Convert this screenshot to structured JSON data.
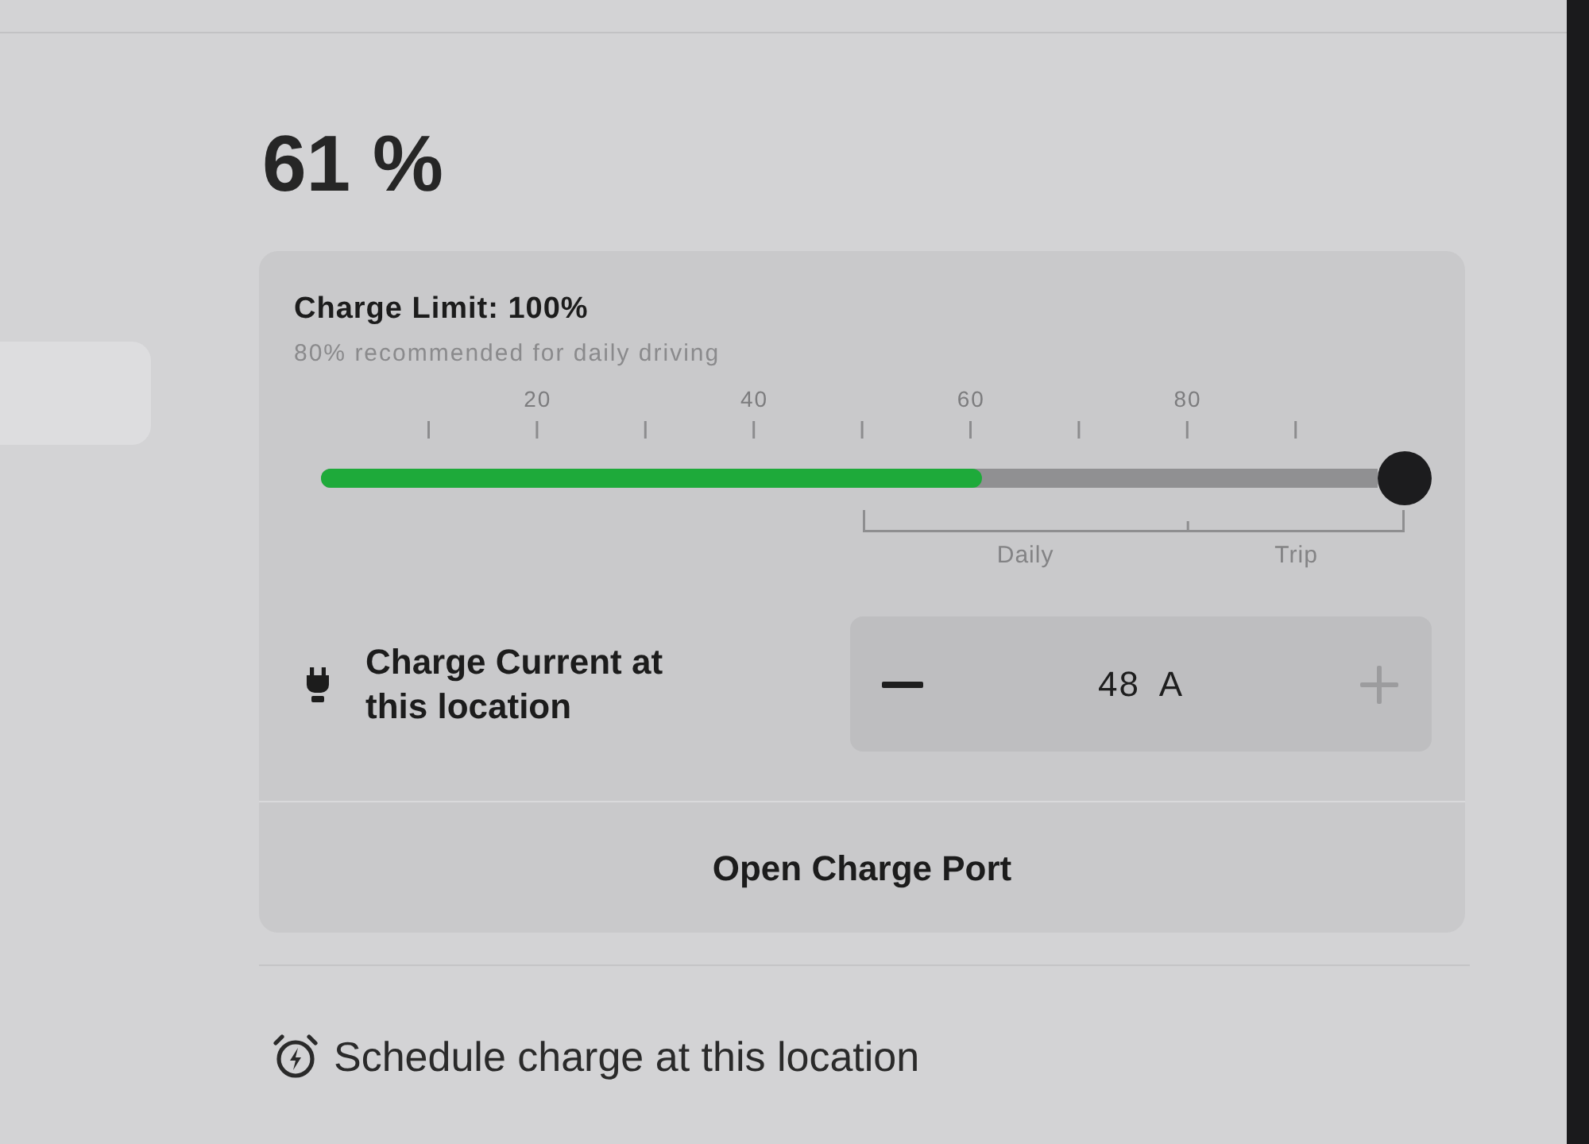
{
  "battery": {
    "reading": "61 %"
  },
  "charge_limit": {
    "title": "Charge Limit: 100%",
    "hint": "80% recommended for daily driving",
    "scale_labels": [
      "20",
      "40",
      "60",
      "80"
    ],
    "charge_fill": {
      "level": 0.61
    },
    "slider": {
      "level": 1
    },
    "range_labels": [
      "Daily",
      "Trip"
    ]
  },
  "charge_current": {
    "label": "Charge Current at this location",
    "value": "48 A",
    "decrease": {
      "disabled": false
    },
    "increase": {
      "disabled": true
    }
  },
  "open_port_button": {
    "label": "Open Charge Port"
  },
  "schedule": {
    "label": "Schedule charge at this location"
  }
}
